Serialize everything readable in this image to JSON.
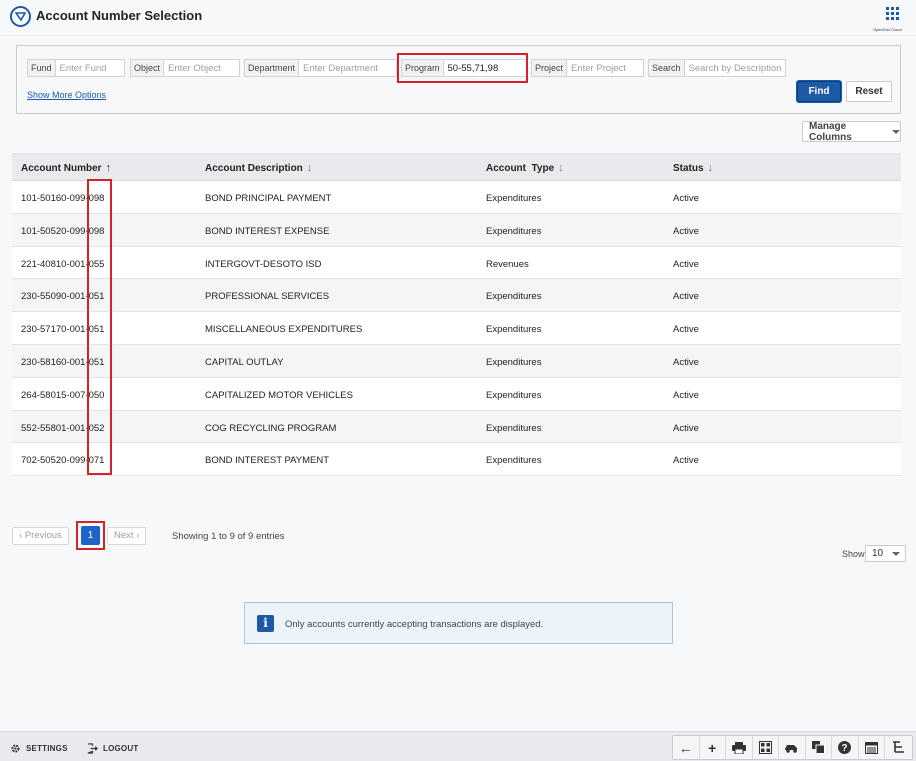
{
  "header": {
    "title": "Account Number Selection",
    "brand": "OpenGov Cloud"
  },
  "filters": {
    "fund": {
      "label": "Fund",
      "placeholder": "Enter Fund",
      "value": ""
    },
    "object": {
      "label": "Object",
      "placeholder": "Enter Object",
      "value": ""
    },
    "department": {
      "label": "Department",
      "placeholder": "Enter Department",
      "value": ""
    },
    "program": {
      "label": "Program",
      "placeholder": "",
      "value": "50-55,71,98"
    },
    "project": {
      "label": "Project",
      "placeholder": "Enter Project",
      "value": ""
    },
    "search": {
      "label": "Search",
      "placeholder": "Search by Description",
      "value": ""
    },
    "show_more": "Show More Options",
    "find_label": "Find",
    "reset_label": "Reset"
  },
  "manage_columns": "Manage Columns",
  "table": {
    "columns": [
      "Account Number",
      "Account Description",
      "Account  Type",
      "Status"
    ],
    "rows": [
      [
        "101-50160-099-098",
        "BOND PRINCIPAL PAYMENT",
        "Expenditures",
        "Active"
      ],
      [
        "101-50520-099-098",
        "BOND INTEREST EXPENSE",
        "Expenditures",
        "Active"
      ],
      [
        "221-40810-001-055",
        "INTERGOVT-DESOTO ISD",
        "Revenues",
        "Active"
      ],
      [
        "230-55090-001-051",
        "PROFESSIONAL SERVICES",
        "Expenditures",
        "Active"
      ],
      [
        "230-57170-001-051",
        "MISCELLANEOUS EXPENDITURES",
        "Expenditures",
        "Active"
      ],
      [
        "230-58160-001-051",
        "CAPITAL OUTLAY",
        "Expenditures",
        "Active"
      ],
      [
        "264-58015-007-050",
        "CAPITALIZED MOTOR VEHICLES",
        "Expenditures",
        "Active"
      ],
      [
        "552-55801-001-052",
        "COG RECYCLING PROGRAM",
        "Expenditures",
        "Active"
      ],
      [
        "702-50520-099-071",
        "BOND INTEREST PAYMENT",
        "Expenditures",
        "Active"
      ]
    ]
  },
  "pagination": {
    "previous": "Previous",
    "next": "Next",
    "current_page": "1",
    "entries_text": "Showing 1 to 9 of 9 entries",
    "show_label": "Show",
    "page_size": "10"
  },
  "info": {
    "message": "Only accounts currently accepting transactions are displayed."
  },
  "footer": {
    "settings": "SETTINGS",
    "logout": "LOGOUT",
    "tools": [
      "back-arrow-icon",
      "plus-icon",
      "print-icon",
      "calculator-icon",
      "vehicle-icon",
      "copy-icon",
      "help-icon",
      "calendar-icon",
      "tree-icon"
    ]
  },
  "colors": {
    "accent": "#1c5aa6",
    "highlight": "#d6202a"
  }
}
